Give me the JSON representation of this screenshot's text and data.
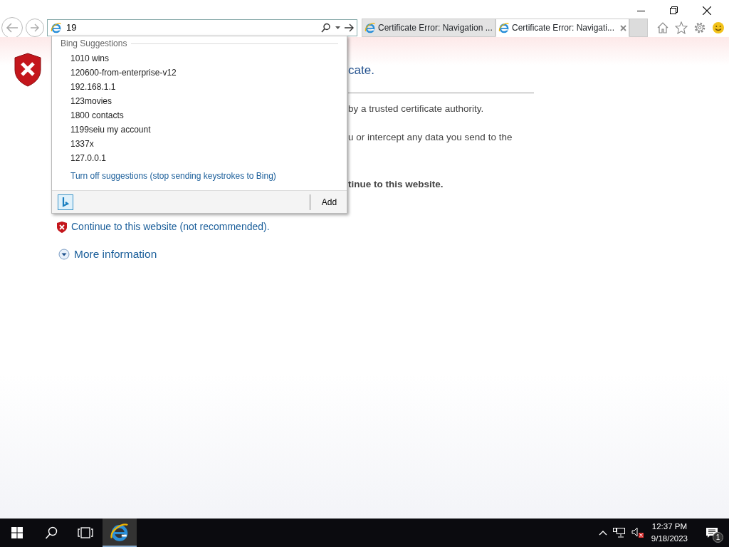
{
  "address_bar": {
    "value": "19"
  },
  "tabs": [
    {
      "title": "Certificate Error: Navigation ...",
      "selected": false,
      "closable": false
    },
    {
      "title": "Certificate Error: Navigati...",
      "selected": true,
      "closable": true
    }
  ],
  "suggestions": {
    "heading": "Bing Suggestions",
    "items": [
      "1010 wins",
      "120600-from-enterprise-v12",
      "192.168.1.1",
      "123movies",
      "1800 contacts",
      "1199seiu my account",
      "1337x",
      "127.0.0.1"
    ],
    "turn_off": "Turn off suggestions (stop sending keystrokes to Bing)",
    "add": "Add"
  },
  "page": {
    "heading_fragment": "cate.",
    "line_fragments": [
      {
        "text": "by a trusted certificate authority.",
        "bold": false
      },
      {
        "text": "u or intercept any data you send to the",
        "bold": false
      },
      {
        "text": "tinue to this website.",
        "bold": true
      }
    ],
    "continue_link": "Continue to this website (not recommended).",
    "more_info": "More information"
  },
  "taskbar": {
    "time": "12:37 PM",
    "date": "9/18/2023",
    "notifications": "1"
  }
}
